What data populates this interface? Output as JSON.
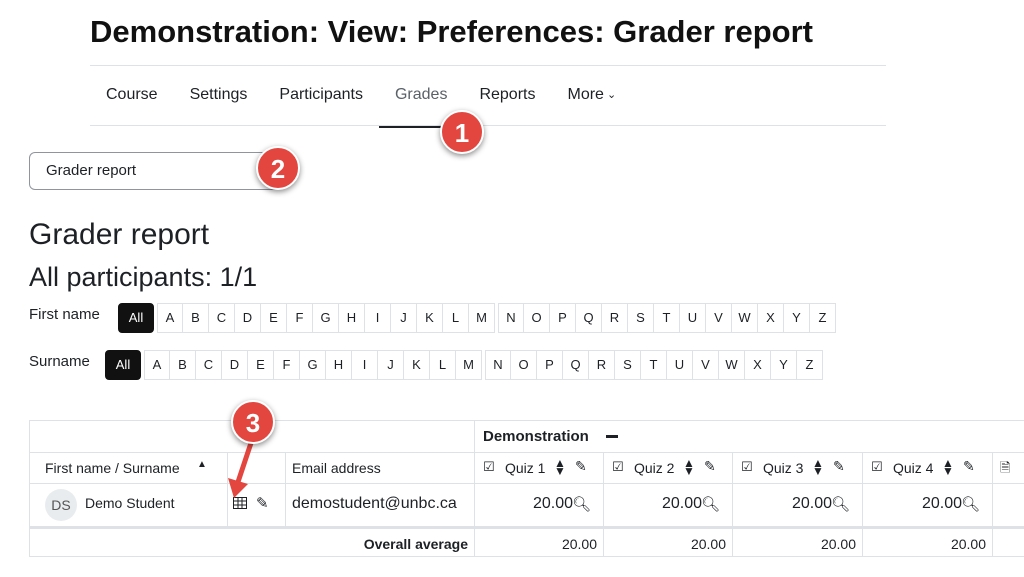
{
  "page": {
    "title": "Demonstration: View: Preferences: Grader report"
  },
  "nav": {
    "items": [
      "Course",
      "Settings",
      "Participants",
      "Grades",
      "Reports",
      "More"
    ],
    "active": "Grades"
  },
  "report_select": {
    "value": "Grader report"
  },
  "badges": [
    "1",
    "2",
    "3"
  ],
  "heading": "Grader report",
  "subheading": "All participants: 1/1",
  "initials_bar": {
    "first_name_label": "First name",
    "surname_label": "Surname",
    "all_label": "All",
    "letters_a_m": [
      "A",
      "B",
      "C",
      "D",
      "E",
      "F",
      "G",
      "H",
      "I",
      "J",
      "K",
      "L",
      "M"
    ],
    "letters_n_z": [
      "N",
      "O",
      "P",
      "Q",
      "R",
      "S",
      "T",
      "U",
      "V",
      "W",
      "X",
      "Y",
      "Z"
    ]
  },
  "grader_table": {
    "category": "Demonstration",
    "column_name": "First name / Surname",
    "column_email": "Email address",
    "quizzes": [
      "Quiz 1",
      "Quiz 2",
      "Quiz 3",
      "Quiz 4"
    ],
    "student": {
      "initials": "DS",
      "name": "Demo Student",
      "email": "demostudent@unbc.ca",
      "grades": [
        "20.00",
        "20.00",
        "20.00",
        "20.00"
      ]
    },
    "average_label": "Overall average",
    "averages": [
      "20.00",
      "20.00",
      "20.00",
      "20.00"
    ]
  },
  "colors": {
    "badge": "#e3453f",
    "text": "#1d2125",
    "active_tab": "#1d2125",
    "all_button": "#111111"
  }
}
